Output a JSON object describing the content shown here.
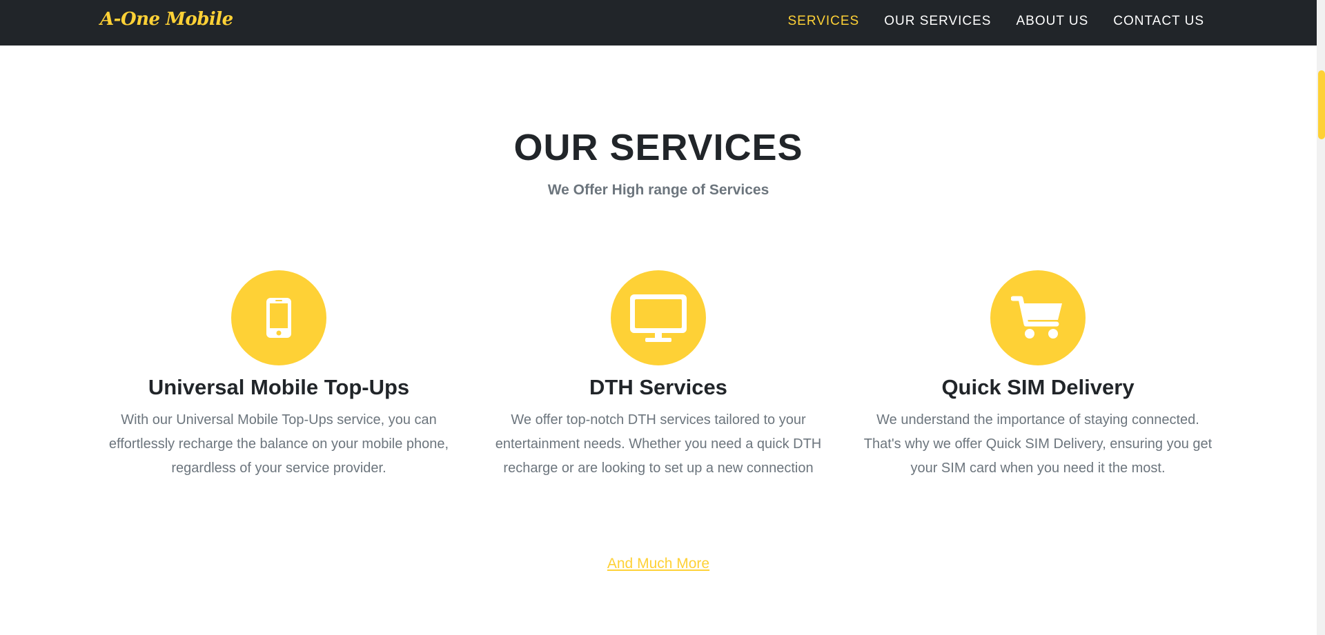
{
  "brand": {
    "name": "A-One Mobile"
  },
  "nav": {
    "items": [
      {
        "label": "SERVICES",
        "active": true
      },
      {
        "label": "OUR SERVICES",
        "active": false
      },
      {
        "label": "ABOUT US",
        "active": false
      },
      {
        "label": "CONTACT US",
        "active": false
      }
    ]
  },
  "section": {
    "title": "OUR SERVICES",
    "subtitle": "We Offer High range of Services"
  },
  "services": [
    {
      "icon": "mobile-phone-icon",
      "title": "Universal Mobile Top-Ups",
      "description": "With our Universal Mobile Top-Ups service, you can effortlessly recharge the balance on your mobile phone, regardless of your service provider."
    },
    {
      "icon": "tv-monitor-icon",
      "title": "DTH Services",
      "description": "We offer top-notch DTH services tailored to your entertainment needs. Whether you need a quick DTH recharge or are looking to set up a new connection"
    },
    {
      "icon": "shopping-cart-icon",
      "title": "Quick SIM Delivery",
      "description": "We understand the importance of staying connected. That's why we offer Quick SIM Delivery, ensuring you get your SIM card when you need it the most."
    }
  ],
  "more_link": {
    "label": "And Much More"
  },
  "colors": {
    "accent": "#fed136",
    "navbar_bg": "#212529",
    "heading": "#212529",
    "muted_text": "#6c757d"
  }
}
